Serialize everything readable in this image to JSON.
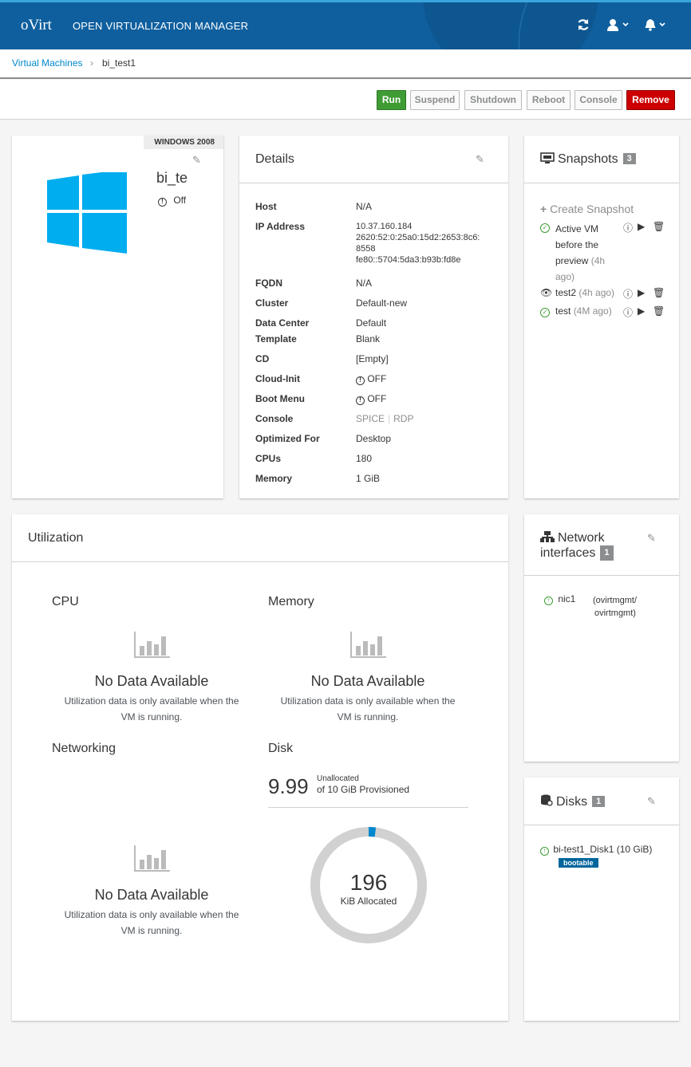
{
  "header": {
    "logo": "oVirt",
    "app_title": "OPEN VIRTUALIZATION MANAGER",
    "icons": [
      "refresh-icon",
      "user-icon",
      "bell-icon"
    ]
  },
  "breadcrumb": {
    "parent": "Virtual Machines",
    "separator": "›",
    "current": "bi_test1"
  },
  "toolbar": {
    "run": "Run",
    "suspend": "Suspend",
    "shutdown": "Shutdown",
    "reboot": "Reboot",
    "console": "Console",
    "remove": "Remove"
  },
  "vm": {
    "os": "WINDOWS 2008",
    "name": "bi_te",
    "status": "Off"
  },
  "details": {
    "title": "Details",
    "host_label": "Host",
    "host": "N/A",
    "ip_label": "IP Address",
    "ip1": "10.37.160.184",
    "ip2": "2620:52:0:25a0:15d2:2653:8c6:",
    "ip3": "8558",
    "ip4": "fe80::5704:5da3:b93b:fd8e",
    "fqdn_label": "FQDN",
    "fqdn": "N/A",
    "cluster_label": "Cluster",
    "cluster": "Default-new",
    "dc_label": "Data Center",
    "dc": "Default",
    "template_label": "Template",
    "template": "Blank",
    "cd_label": "CD",
    "cd": "[Empty]",
    "cloudinit_label": "Cloud-Init",
    "cloudinit": "OFF",
    "bootmenu_label": "Boot Menu",
    "bootmenu": "OFF",
    "console_label": "Console",
    "console_spice": "SPICE",
    "console_rdp": "RDP",
    "optimized_label": "Optimized For",
    "optimized": "Desktop",
    "cpus_label": "CPUs",
    "cpus": "180",
    "memory_label": "Memory",
    "memory": "1 GiB"
  },
  "snapshots": {
    "title": "Snapshots",
    "count": "3",
    "create": "Create Snapshot",
    "items": [
      {
        "l1": "Active VM",
        "l2": "before the",
        "l3": "preview",
        "l3b": "(4h",
        "l4": "ago)"
      },
      {
        "name": "test2",
        "age": "(4h ago)"
      },
      {
        "name": "test",
        "age": "(4M ago)"
      }
    ]
  },
  "utilization": {
    "title": "Utilization",
    "cpu": "CPU",
    "memory": "Memory",
    "networking": "Networking",
    "disk": "Disk",
    "nodata": "No Data Available",
    "nodata_sub1": "Utilization data is only available when the",
    "nodata_sub2": "VM is running.",
    "disk_value": "9.99",
    "disk_unalloc": "Unallocated",
    "disk_prov": "of 10 GiB Provisioned",
    "donut_value": "196",
    "donut_label": "KiB Allocated",
    "donut_allocated_fraction": 0.02
  },
  "nics": {
    "title_l1": "Network",
    "title_l2": "interfaces",
    "count": "1",
    "items": [
      {
        "name": "nic1",
        "net1": "(ovirtmgmt/",
        "net2": "ovirtmgmt)"
      }
    ]
  },
  "disks": {
    "title": "Disks",
    "count": "1",
    "items": [
      {
        "name": "bi-test1_Disk1",
        "size": "(10 GiB)",
        "badge": "bootable"
      }
    ]
  },
  "colors": {
    "header": "#0f5f9e",
    "run": "#3f9c35",
    "remove": "#cc0000",
    "link": "#0088ce",
    "windows": "#00adef"
  }
}
